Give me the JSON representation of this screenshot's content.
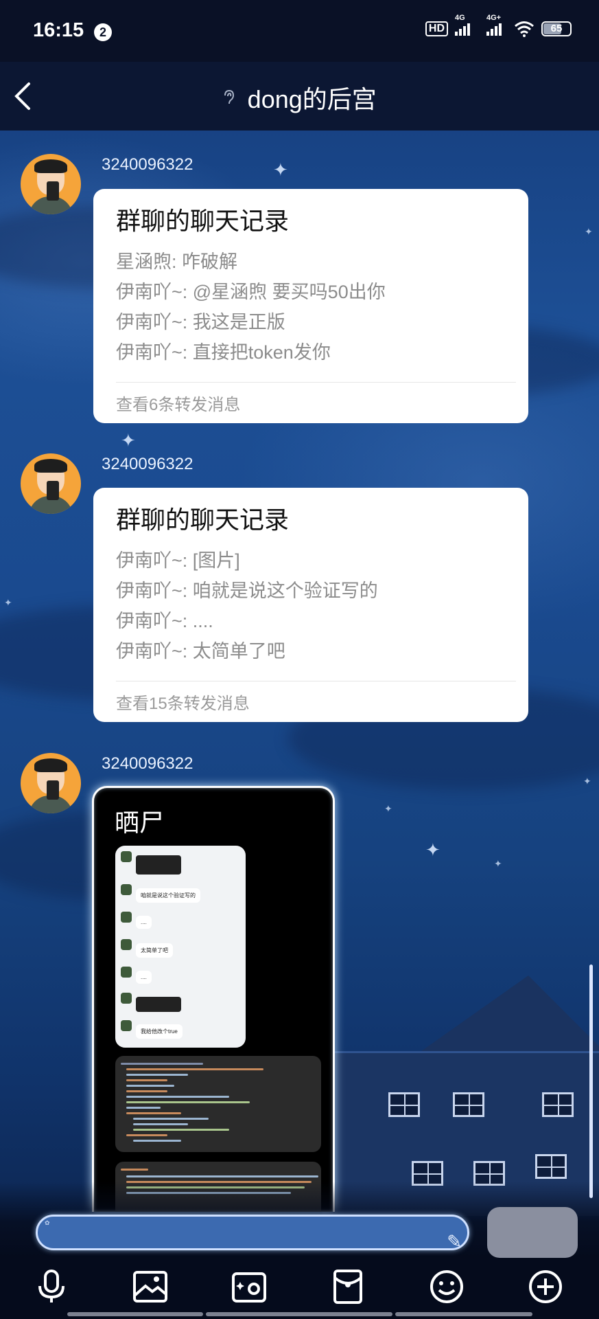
{
  "status_bar": {
    "time": "16:15",
    "notification_count": "2",
    "hd_label": "HD",
    "network1": "4G",
    "network2": "4G+",
    "battery": "65"
  },
  "header": {
    "title": "dong的后宫"
  },
  "messages": [
    {
      "sender": "3240096322",
      "card_title": "群聊的聊天记录",
      "lines": [
        "星涵煦: 咋破解",
        "伊南吖~: @星涵煦 要买吗50出你",
        "伊南吖~: 我这是正版",
        "伊南吖~: 直接把token发你"
      ],
      "footer": "查看6条转发消息"
    },
    {
      "sender": "3240096322",
      "card_title": "群聊的聊天记录",
      "lines": [
        "伊南吖~: [图片]",
        "伊南吖~: 咱就是说这个验证写的",
        "伊南吖~: ....",
        "伊南吖~: 太简单了吧"
      ],
      "footer": "查看15条转发消息"
    },
    {
      "sender": "3240096322",
      "card_title": "晒尸",
      "mini_bubbles": [
        "咱就是说这个验证写的",
        "....",
        "太简单了吧",
        "....",
        "我给他改个true"
      ]
    }
  ],
  "input": {
    "placeholder": ""
  },
  "colors": {
    "header_bg": "#0c1733",
    "input_bg": "#3c6ab0",
    "send_button": "#8a8f9f",
    "card_bg": "#ffffff",
    "secondary_text": "#8c8c8c"
  },
  "toolbar_icons": [
    "mic-icon",
    "image-icon",
    "camera-icon",
    "red-packet-icon",
    "emoji-icon",
    "plus-icon"
  ]
}
